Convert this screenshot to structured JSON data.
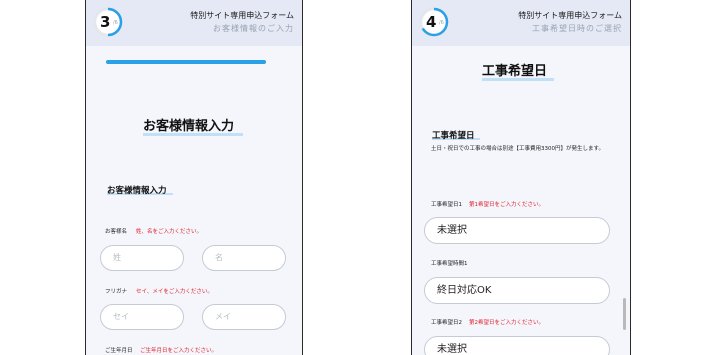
{
  "left": {
    "step_number": "3",
    "step_total": "/6",
    "header_title": "特別サイト専用申込フォーム",
    "header_subtitle": "お客様情報のご入力",
    "page_heading": "お客様情報入力",
    "section_heading": "お客様情報入力",
    "fields": {
      "name_label": "お客様名",
      "name_hint": "姓、名をご入力ください。",
      "last_name_placeholder": "姓",
      "first_name_placeholder": "名",
      "furigana_label": "フリガナ",
      "furigana_hint": "セイ、メイをご入力ください。",
      "last_kana_placeholder": "セイ",
      "first_kana_placeholder": "メイ",
      "birthday_label": "ご生年月日",
      "birthday_hint": "ご生年月日をご入力ください。"
    }
  },
  "right": {
    "step_number": "4",
    "step_total": "/6",
    "header_title": "特別サイト専用申込フォーム",
    "header_subtitle": "工事希望日時のご選択",
    "page_heading": "工事希望日",
    "section_heading": "工事希望日",
    "note": "土日・祝日での工事の場合は別途【工事費用3300円】が発生します。",
    "fields": {
      "date1_label": "工事希望日1",
      "date1_hint": "第1希望日をご入力ください。",
      "date1_value": "未選択",
      "time1_label": "工事希望時間1",
      "time1_value": "終日対応OK",
      "date2_label": "工事希望日2",
      "date2_hint": "第2希望日をご入力ください。",
      "date2_value": "未選択"
    }
  },
  "colors": {
    "accent_blue": "#2aa0e6",
    "error_red": "#e0202a",
    "header_bg": "#e4e9f5",
    "underline": "#bfe0f7"
  },
  "progress": {
    "left_fraction": 0.5,
    "right_fraction": 0.667
  }
}
